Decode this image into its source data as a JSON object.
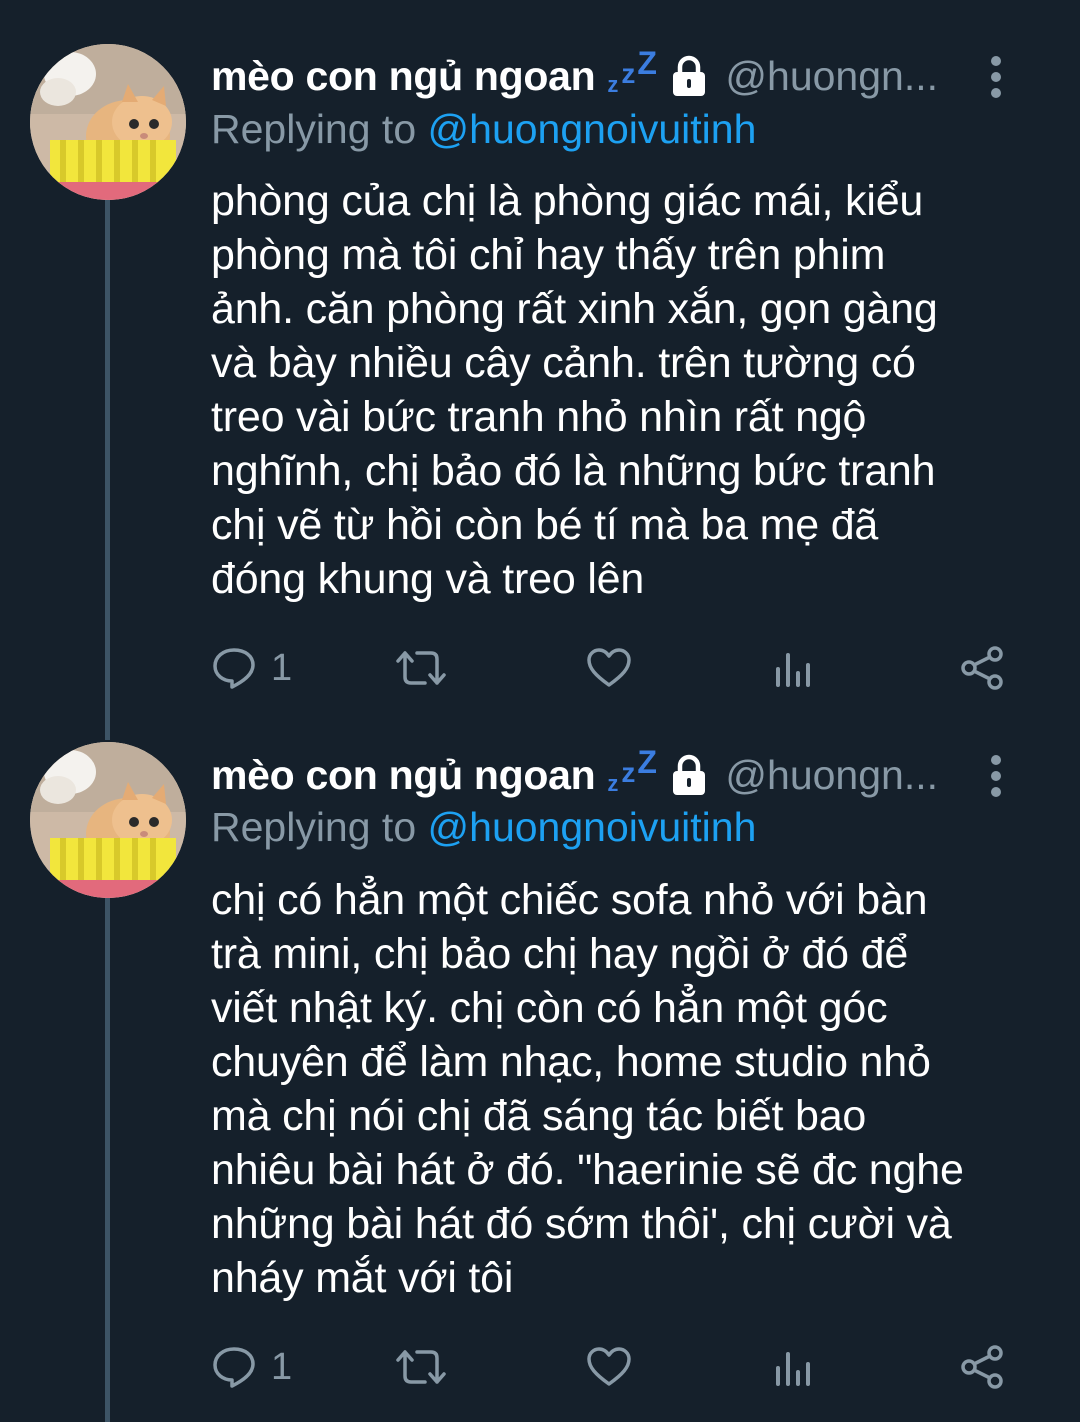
{
  "tweets": [
    {
      "display_name": "mèo con ngủ ngoan",
      "status_emoji": "zzz",
      "handle": "@huongn...",
      "replying_prefix": "Replying to",
      "replying_to": "@huongnoivuitinh",
      "body_lines": [
        "phòng của chị là phòng giác mái, kiểu",
        "phòng mà tôi chỉ hay thấy trên phim",
        "ảnh. căn phòng rất xinh xắn, gọn gàng",
        "và bày nhiều cây cảnh. trên tường có",
        "treo vài bức tranh nhỏ nhìn rất ngộ",
        "nghĩnh, chị bảo đó là những bức tranh",
        "chị vẽ từ hồi còn bé tí mà ba mẹ đã",
        "đóng khung và treo lên"
      ],
      "reply_count": "1"
    },
    {
      "display_name": "mèo con ngủ ngoan",
      "status_emoji": "zzz",
      "handle": "@huongn...",
      "replying_prefix": "Replying to",
      "replying_to": "@huongnoivuitinh",
      "body_lines": [
        "chị có hẳn một chiếc sofa nhỏ với bàn",
        "trà mini, chị bảo chị hay ngồi ở đó để",
        "viết nhật ký. chị còn có hẳn một góc",
        "chuyên để làm nhạc, home studio nhỏ",
        "mà chị nói chị đã sáng tác biết bao",
        "nhiêu bài hát ở đó. \"haerinie sẽ đc nghe",
        "những bài hát đó sớm thôi', chị cười và",
        "nháy mắt với tôi"
      ],
      "reply_count": "1"
    }
  ],
  "colors": {
    "background": "#15202b",
    "text": "#ffffff",
    "secondary": "#8899a6",
    "mention": "#1da1f2",
    "thread_line": "#3d5466",
    "zzz": "#3b7de0"
  },
  "icons": [
    "lock-icon",
    "more-icon",
    "reply-icon",
    "retweet-icon",
    "like-icon",
    "analytics-icon",
    "share-icon"
  ]
}
